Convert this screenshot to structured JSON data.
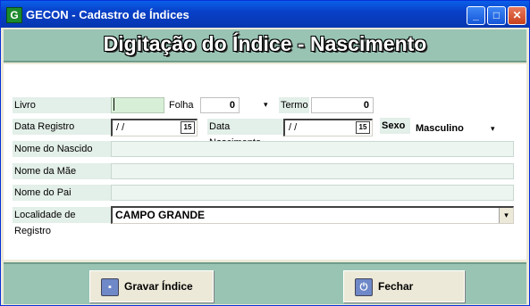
{
  "window": {
    "title": "GECON - Cadastro de Índices",
    "app_icon_letter": "G",
    "controls": {
      "minimize": "_",
      "maximize": "□",
      "close": "✕"
    }
  },
  "heading": "Digitação do  Índice - Nascimento",
  "form": {
    "livro_label": "Livro",
    "livro_value": "",
    "folha_label": "Folha",
    "folha_value": "0",
    "folha_arrow": "▾",
    "termo_label": "Termo",
    "termo_value": "0",
    "data_registro_label": "Data Registro",
    "data_registro_value": " / /",
    "data_nascimento_label": "Data Nascimento",
    "data_nascimento_value": " / /",
    "calendar_icon_text": "15",
    "sexo_label": "Sexo",
    "sexo_value": "Masculino",
    "sexo_arrow": "▾",
    "nome_nascido_label": "Nome do Nascido",
    "nome_nascido_value": "",
    "nome_mae_label": "Nome da Mãe",
    "nome_mae_value": "",
    "nome_pai_label": "Nome do Pai",
    "nome_pai_value": "",
    "localidade_label": "Localidade de Registro",
    "localidade_value": "CAMPO GRANDE",
    "localidade_arrow": "▾"
  },
  "buttons": {
    "gravar_label": "Gravar Índice",
    "fechar_label": "Fechar"
  },
  "colors": {
    "band": "#99c4b4",
    "field_bg": "#edf5f1",
    "titlebar": "#0a5fe8"
  }
}
